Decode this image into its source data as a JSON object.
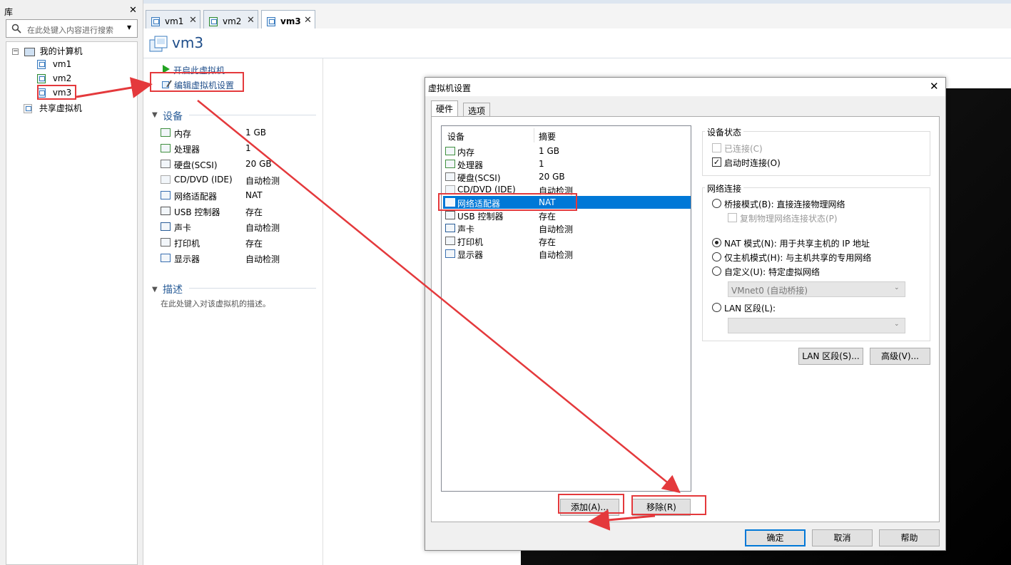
{
  "library": {
    "title": "库",
    "close": "✕",
    "search_placeholder": "在此处键入内容进行搜索",
    "tree": {
      "root": "我的计算机",
      "vms": [
        "vm1",
        "vm2",
        "vm3"
      ],
      "shared": "共享虚拟机"
    }
  },
  "tabs": [
    {
      "label": "vm1",
      "close": "✕"
    },
    {
      "label": "vm2",
      "close": "✕"
    },
    {
      "label": "vm3",
      "close": "✕",
      "active": true
    }
  ],
  "vm": {
    "title": "vm3",
    "actions": {
      "power_on": "开启此虚拟机",
      "edit_settings": "编辑虚拟机设置"
    },
    "devices_header": "设备",
    "devices": [
      {
        "name": "内存",
        "summary": "1 GB",
        "icon": "memory-icon"
      },
      {
        "name": "处理器",
        "summary": "1",
        "icon": "cpu-icon"
      },
      {
        "name": "硬盘(SCSI)",
        "summary": "20 GB",
        "icon": "hdd-icon"
      },
      {
        "name": "CD/DVD (IDE)",
        "summary": "自动检测",
        "icon": "cd-icon"
      },
      {
        "name": "网络适配器",
        "summary": "NAT",
        "icon": "network-icon"
      },
      {
        "name": "USB 控制器",
        "summary": "存在",
        "icon": "usb-icon"
      },
      {
        "name": "声卡",
        "summary": "自动检测",
        "icon": "sound-icon"
      },
      {
        "name": "打印机",
        "summary": "存在",
        "icon": "printer-icon"
      },
      {
        "name": "显示器",
        "summary": "自动检测",
        "icon": "display-icon"
      }
    ],
    "description_header": "描述",
    "description_placeholder": "在此处键入对该虚拟机的描述。"
  },
  "dialog": {
    "title": "虚拟机设置",
    "close": "✕",
    "tabs": [
      "硬件",
      "选项"
    ],
    "list_headers": {
      "device": "设备",
      "summary": "摘要"
    },
    "selected_index": 4,
    "add_button": "添加(A)...",
    "remove_button": "移除(R)",
    "device_status": {
      "title": "设备状态",
      "connected": "已连接(C)",
      "connect_on_power": "启动时连接(O)"
    },
    "network": {
      "title": "网络连接",
      "bridged": "桥接模式(B): 直接连接物理网络",
      "replicate": "复制物理网络连接状态(P)",
      "nat": "NAT 模式(N): 用于共享主机的 IP 地址",
      "host_only": "仅主机模式(H): 与主机共享的专用网络",
      "custom": "自定义(U): 特定虚拟网络",
      "custom_combo": "VMnet0 (自动桥接)",
      "lan": "LAN 区段(L):",
      "lan_combo": ""
    },
    "lan_segments_button": "LAN 区段(S)...",
    "advanced_button": "高级(V)...",
    "ok": "确定",
    "cancel": "取消",
    "help": "帮助"
  },
  "colors": {
    "accent": "#0078d7",
    "annotation": "#e4393c",
    "link": "#1f4e8a"
  }
}
